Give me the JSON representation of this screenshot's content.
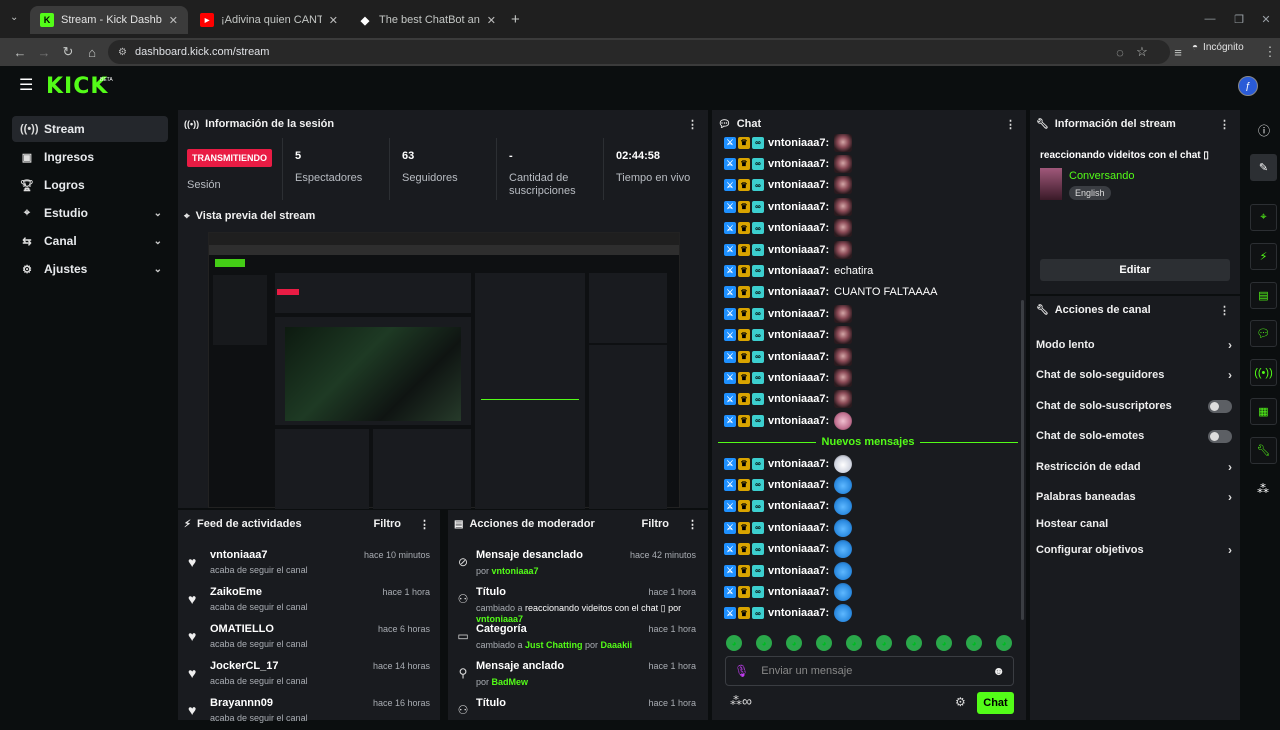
{
  "browser": {
    "tabs": [
      {
        "title": "Stream - Kick Dashboard",
        "active": true
      },
      {
        "title": "¡Adivina quien CANTA! Recono",
        "active": false
      },
      {
        "title": "The best ChatBot and Widgets",
        "active": false
      }
    ],
    "url": "dashboard.kick.com/stream",
    "profile_label": "Incógnito"
  },
  "app": {
    "logo": "KICK",
    "beta": "BETA",
    "accent": "#53fc18"
  },
  "sidebar": {
    "items": [
      {
        "label": "Stream",
        "icon": "broadcast-icon"
      },
      {
        "label": "Ingresos",
        "icon": "revenue-icon"
      },
      {
        "label": "Logros",
        "icon": "trophy-icon"
      },
      {
        "label": "Estudio",
        "icon": "studio-icon"
      },
      {
        "label": "Canal",
        "icon": "channel-icon"
      },
      {
        "label": "Ajustes",
        "icon": "gear-icon"
      }
    ]
  },
  "session": {
    "title": "Información de la sesión",
    "status_badge": "TRANSMITIENDO",
    "status_label": "Sesión",
    "stats": [
      {
        "value": "5",
        "label": "Espectadores"
      },
      {
        "value": "63",
        "label": "Seguidores"
      },
      {
        "value": "-",
        "label": "Cantidad de suscripciones"
      },
      {
        "value": "02:44:58",
        "label": "Tiempo en vivo"
      }
    ]
  },
  "preview": {
    "title": "Vista previa del stream"
  },
  "activity": {
    "title": "Feed de actividades",
    "filter": "Filtro",
    "items": [
      {
        "name": "vntoniaaa7",
        "action": "acaba de seguir el canal",
        "time": "hace 10 minutos"
      },
      {
        "name": "ZaikoEme",
        "action": "acaba de seguir el canal",
        "time": "hace 1 hora"
      },
      {
        "name": "OMATIELLO",
        "action": "acaba de seguir el canal",
        "time": "hace 6 horas"
      },
      {
        "name": "JockerCL_17",
        "action": "acaba de seguir el canal",
        "time": "hace 14 horas"
      },
      {
        "name": "Brayannn09",
        "action": "acaba de seguir el canal",
        "time": "hace 16 horas"
      }
    ]
  },
  "moderator": {
    "title": "Acciones de moderador",
    "filter": "Filtro",
    "items": [
      {
        "title": "Mensaje desanclado",
        "pre": "por ",
        "hl": "vntoniaaa7",
        "mid": "",
        "hl2": "",
        "time": "hace 42 minutos",
        "icon": "unpin-icon"
      },
      {
        "title": "Título",
        "pre": "cambiado a ",
        "hl": "",
        "mid": "reaccionando videitos con el chat ▯ por",
        "hl2": "vntoniaaa7",
        "time": "hace 1 hora",
        "icon": "title-icon"
      },
      {
        "title": "Categoría",
        "pre": "cambiado a ",
        "hl": "Just Chatting",
        "mid": " por ",
        "hl2": "Daaakii",
        "time": "hace 1 hora",
        "icon": "category-icon"
      },
      {
        "title": "Mensaje anclado",
        "pre": "por ",
        "hl": "BadMew",
        "mid": "",
        "hl2": "",
        "time": "hace 1 hora",
        "icon": "pin-icon"
      },
      {
        "title": "Título",
        "pre": "",
        "hl": "",
        "mid": "",
        "hl2": "",
        "time": "hace 1 hora",
        "icon": "title-icon"
      }
    ]
  },
  "chat": {
    "title": "Chat",
    "messages": [
      {
        "user": "vntoniaaa7:",
        "text": "",
        "emote": "face"
      },
      {
        "user": "vntoniaaa7:",
        "text": "",
        "emote": "face"
      },
      {
        "user": "vntoniaaa7:",
        "text": "",
        "emote": "face"
      },
      {
        "user": "vntoniaaa7:",
        "text": "",
        "emote": "face"
      },
      {
        "user": "vntoniaaa7:",
        "text": "",
        "emote": "face"
      },
      {
        "user": "vntoniaaa7:",
        "text": "",
        "emote": "face"
      },
      {
        "user": "vntoniaaa7:",
        "text": "echatira",
        "emote": ""
      },
      {
        "user": "vntoniaaa7:",
        "text": "CUANTO FALTAAAA",
        "emote": ""
      },
      {
        "user": "vntoniaaa7:",
        "text": "",
        "emote": "face"
      },
      {
        "user": "vntoniaaa7:",
        "text": "",
        "emote": "face"
      },
      {
        "user": "vntoniaaa7:",
        "text": "",
        "emote": "face"
      },
      {
        "user": "vntoniaaa7:",
        "text": "",
        "emote": "face"
      },
      {
        "user": "vntoniaaa7:",
        "text": "",
        "emote": "face"
      },
      {
        "user": "vntoniaaa7:",
        "text": "",
        "emote": "pink"
      }
    ],
    "new_messages_label": "Nuevos mensajes",
    "new_messages": [
      {
        "user": "vntoniaaa7:",
        "emote": "ghost"
      },
      {
        "user": "vntoniaaa7:",
        "emote": "cat"
      },
      {
        "user": "vntoniaaa7:",
        "emote": "cat"
      },
      {
        "user": "vntoniaaa7:",
        "emote": "cat"
      },
      {
        "user": "vntoniaaa7:",
        "emote": "cat"
      },
      {
        "user": "vntoniaaa7:",
        "emote": "cat"
      },
      {
        "user": "vntoniaaa7:",
        "emote": "cat"
      },
      {
        "user": "vntoniaaa7:",
        "emote": "cat"
      }
    ],
    "input_placeholder": "Enviar un mensaje",
    "send_label": "Chat",
    "infinity": "∞"
  },
  "stream_info": {
    "title": "Información del stream",
    "stream_title": "reaccionando videitos con el chat ▯",
    "category": "Conversando",
    "language": "English",
    "edit_label": "Editar"
  },
  "channel_actions": {
    "title": "Acciones de canal",
    "items": [
      {
        "label": "Modo lento",
        "kind": "chevron"
      },
      {
        "label": "Chat de solo-seguidores",
        "kind": "chevron"
      },
      {
        "label": "Chat de solo-suscriptores",
        "kind": "toggle"
      },
      {
        "label": "Chat de solo-emotes",
        "kind": "toggle"
      },
      {
        "label": "Restricción de edad",
        "kind": "chevron"
      },
      {
        "label": "Palabras baneadas",
        "kind": "chevron"
      },
      {
        "label": "Hostear canal",
        "kind": "none"
      },
      {
        "label": "Configurar objetivos",
        "kind": "chevron"
      }
    ]
  }
}
